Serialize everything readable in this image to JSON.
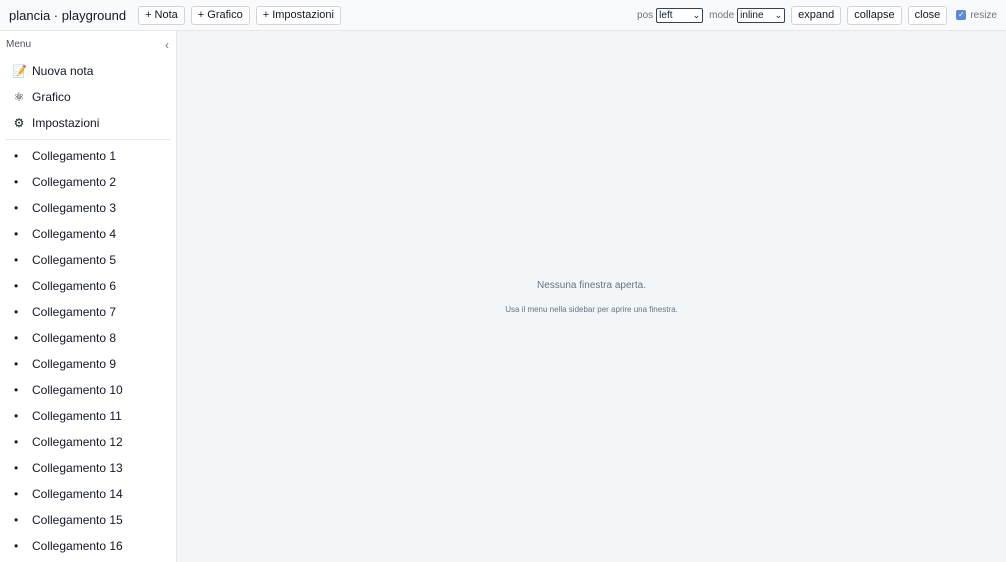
{
  "topbar": {
    "title": "plancia · playground",
    "buttons": {
      "nota": "+ Nota",
      "grafico": "+ Grafico",
      "impostazioni": "+ Impostazioni"
    },
    "pos_label": "pos",
    "pos_value": "left",
    "mode_label": "mode",
    "mode_value": "inline",
    "expand": "expand",
    "collapse": "collapse",
    "close": "close",
    "resize_label": "resize",
    "resize_checked": true
  },
  "sidebar": {
    "title": "Menu",
    "collapse_icon": "chevron-left-icon",
    "menu": [
      {
        "label": "Nuova nota",
        "icon": "memo-icon"
      },
      {
        "label": "Grafico",
        "icon": "atom-icon"
      },
      {
        "label": "Impostazioni",
        "icon": "gear-icon"
      }
    ],
    "links": [
      "Collegamento 1",
      "Collegamento 2",
      "Collegamento 3",
      "Collegamento 4",
      "Collegamento 5",
      "Collegamento 6",
      "Collegamento 7",
      "Collegamento 8",
      "Collegamento 9",
      "Collegamento 10",
      "Collegamento 11",
      "Collegamento 12",
      "Collegamento 13",
      "Collegamento 14",
      "Collegamento 15",
      "Collegamento 16"
    ]
  },
  "main": {
    "empty_title": "Nessuna finestra aperta.",
    "empty_subtitle": "Usa il menu nella sidebar per aprire una finestra."
  },
  "colors": {
    "main_background": "#f3f6f9",
    "topbar_background": "#f9fafb",
    "checkbox_accent": "#5b8bd8"
  }
}
